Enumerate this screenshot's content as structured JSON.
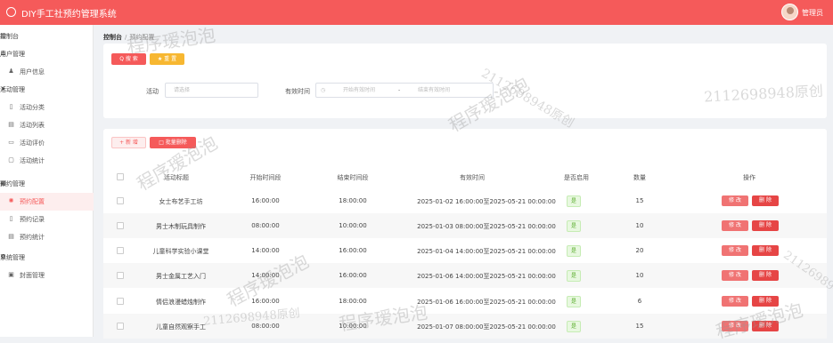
{
  "app": {
    "title": "DIY手工社预约管理系统",
    "user": "管理员"
  },
  "sidebar": {
    "items": [
      {
        "type": "group",
        "icon": "chart-icon",
        "glyph": "▥",
        "label": "控制台"
      },
      {
        "type": "group",
        "icon": "user-icon",
        "glyph": "♙",
        "label": "用户管理"
      },
      {
        "type": "sub",
        "icon": "person-icon",
        "glyph": "♟",
        "label": "用户信息"
      },
      {
        "type": "group",
        "icon": "send-icon",
        "glyph": "➤",
        "label": "活动管理"
      },
      {
        "type": "sub",
        "icon": "bookmark-icon",
        "glyph": "▯",
        "label": "活动分类"
      },
      {
        "type": "sub",
        "icon": "list-icon",
        "glyph": "▤",
        "label": "活动列表"
      },
      {
        "type": "sub",
        "icon": "comment-icon",
        "glyph": "▭",
        "label": "活动评价"
      },
      {
        "type": "sub",
        "icon": "document-icon",
        "glyph": "▢",
        "label": "活动统计"
      },
      {
        "type": "group",
        "icon": "calendar-icon",
        "glyph": "▦",
        "label": "预约管理"
      },
      {
        "type": "sub",
        "icon": "sun-icon",
        "glyph": "✺",
        "label": "预约配置",
        "active": true
      },
      {
        "type": "sub",
        "icon": "record-icon",
        "glyph": "▯",
        "label": "预约记录"
      },
      {
        "type": "sub",
        "icon": "stats-icon",
        "glyph": "▤",
        "label": "预约统计"
      },
      {
        "type": "group",
        "icon": "gear-icon",
        "glyph": "✿",
        "label": "系统管理"
      },
      {
        "type": "sub",
        "icon": "image-icon",
        "glyph": "▣",
        "label": "封面管理"
      }
    ]
  },
  "breadcrumb": {
    "home": "控制台",
    "separator": "/",
    "current": "预约配置"
  },
  "search": {
    "search_label": "Q 搜 索",
    "reset_label": "★ 重 置",
    "activity_label": "活动",
    "activity_placeholder": "请选择",
    "time_label": "有效时间",
    "start_placeholder": "开始有效时间",
    "range_sep": "-",
    "end_placeholder": "结束有效时间"
  },
  "actions": {
    "add_label": "+ 新 增",
    "batch_delete_label": "□ 批量删除"
  },
  "table": {
    "columns": [
      "活动标题",
      "开始时间段",
      "结束时间段",
      "有效时间",
      "是否启用",
      "数量",
      "操作"
    ],
    "edit_label": "修 改",
    "delete_label": "删 除",
    "rows": [
      {
        "title": "女士布艺手工坊",
        "start": "16:00:00",
        "end": "18:00:00",
        "valid": "2025-01-02 16:00:00至2025-05-21 00:00:00",
        "enabled": "是",
        "qty": "15"
      },
      {
        "title": "男士木制玩具制作",
        "start": "08:00:00",
        "end": "10:00:00",
        "valid": "2025-01-03 08:00:00至2025-05-21 00:00:00",
        "enabled": "是",
        "qty": "10"
      },
      {
        "title": "儿童科学实验小课堂",
        "start": "14:00:00",
        "end": "16:00:00",
        "valid": "2025-01-04 14:00:00至2025-05-21 00:00:00",
        "enabled": "是",
        "qty": "20"
      },
      {
        "title": "男士金属工艺入门",
        "start": "14:00:00",
        "end": "16:00:00",
        "valid": "2025-01-06 14:00:00至2025-05-21 00:00:00",
        "enabled": "是",
        "qty": "10"
      },
      {
        "title": "情侣浪漫蜡烛制作",
        "start": "16:00:00",
        "end": "18:00:00",
        "valid": "2025-01-06 16:00:00至2025-05-21 00:00:00",
        "enabled": "是",
        "qty": "6"
      },
      {
        "title": "儿童自然观察手工",
        "start": "08:00:00",
        "end": "10:00:00",
        "valid": "2025-01-07 08:00:00至2025-05-21 00:00:00",
        "enabled": "是",
        "qty": "15"
      }
    ]
  },
  "watermarks": [
    "程序瑷泡泡",
    "2112698948原创"
  ],
  "colors": {
    "primary": "#f55a5a",
    "reset": "#f7b731",
    "enabled_bg": "#e8f8e0"
  }
}
